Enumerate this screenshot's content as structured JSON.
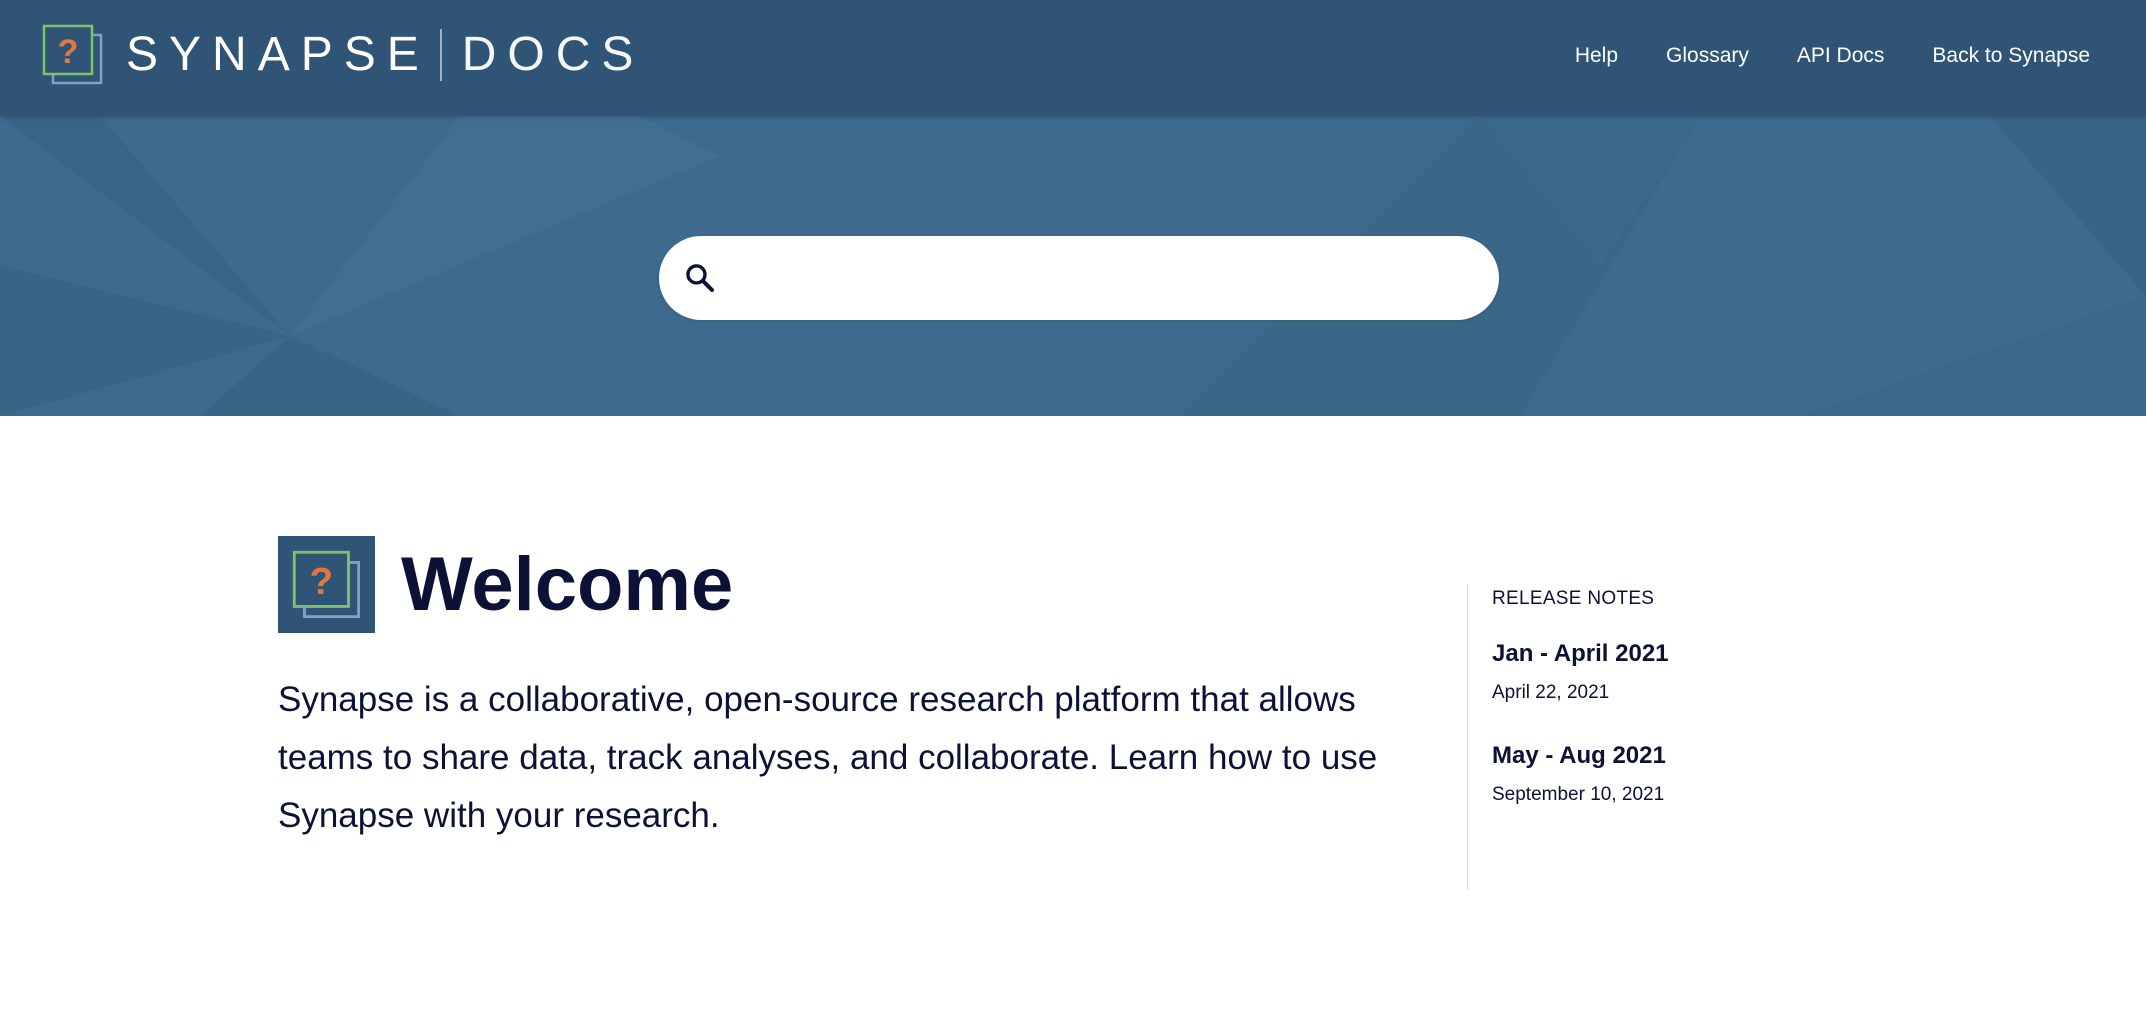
{
  "header": {
    "brand_name": "SYNAPSE",
    "brand_sub": "DOCS",
    "nav": [
      {
        "label": "Help"
      },
      {
        "label": "Glossary"
      },
      {
        "label": "API Docs"
      },
      {
        "label": "Back to Synapse"
      }
    ]
  },
  "hero": {
    "search": {
      "value": "",
      "placeholder": "",
      "icon": "search-icon"
    }
  },
  "main": {
    "title": "Welcome",
    "description": "Synapse is a collaborative, open-source research platform that allows teams to share data, track analyses, and collaborate. Learn how to use Synapse with your research."
  },
  "release_notes": {
    "heading": "RELEASE NOTES",
    "items": [
      {
        "title": "Jan - April 2021",
        "date": "April 22, 2021"
      },
      {
        "title": "May - Aug 2021",
        "date": "September 10, 2021"
      }
    ]
  },
  "colors": {
    "header_bg": "#2f5475",
    "hero_bg": "#3d6a8e",
    "text_dark": "#0b1236",
    "logo_green": "#7cc36a",
    "logo_orange": "#e07a3c",
    "logo_blue": "#7fa3c6"
  }
}
